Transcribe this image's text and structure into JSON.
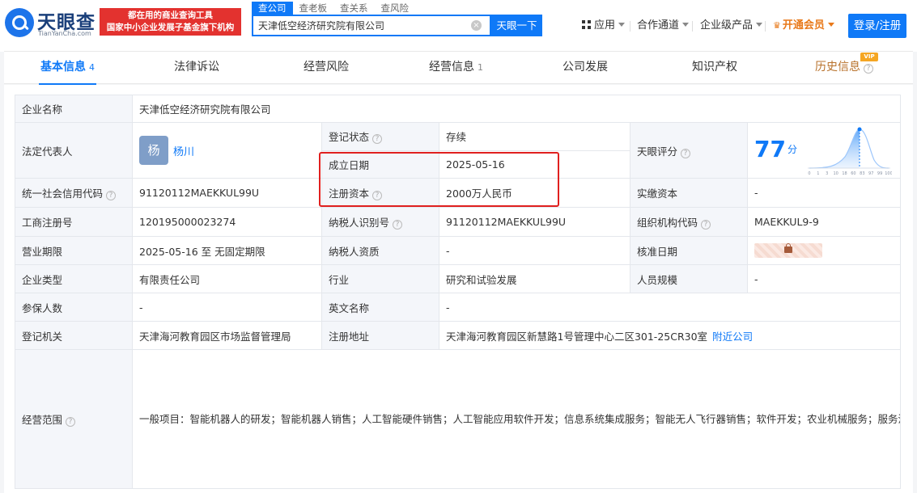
{
  "header": {
    "logo_name": "天眼查",
    "logo_domain": "TianYanCha.com",
    "slogan_line1": "都在用的商业查询工具",
    "slogan_line2": "国家中小企业发展子基金旗下机构",
    "search_tabs": [
      "查公司",
      "查老板",
      "查关系",
      "查风险"
    ],
    "search_value": "天津低空经济研究院有限公司",
    "search_button": "天眼一下",
    "nav_apps": "应用",
    "nav_channel": "合作通道",
    "nav_enterprise": "企业级产品",
    "nav_vip": "开通会员",
    "login": "登录/注册"
  },
  "tabs": [
    {
      "label": "基本信息",
      "count": "4"
    },
    {
      "label": "法律诉讼",
      "count": ""
    },
    {
      "label": "经营风险",
      "count": ""
    },
    {
      "label": "经营信息",
      "count": "1"
    },
    {
      "label": "公司发展",
      "count": ""
    },
    {
      "label": "知识产权",
      "count": ""
    },
    {
      "label": "历史信息",
      "count": ""
    }
  ],
  "vip_badge": "VIP",
  "info": {
    "company_name_label": "企业名称",
    "company_name": "天津低空经济研究院有限公司",
    "legal_rep_label": "法定代表人",
    "legal_rep_avatar": "杨",
    "legal_rep": "杨川",
    "reg_status_label": "登记状态",
    "reg_status": "存续",
    "score_label": "天眼评分",
    "score": "77",
    "score_unit": "分",
    "score_axis": [
      "0",
      "1",
      "3",
      "10",
      "18",
      "60",
      "83",
      "97",
      "99",
      "100"
    ],
    "founded_label": "成立日期",
    "founded": "2025-05-16",
    "uscc_label": "统一社会信用代码",
    "uscc": "91120112MAEKKUL99U",
    "reg_capital_label": "注册资本",
    "reg_capital": "2000万人民币",
    "paid_capital_label": "实缴资本",
    "paid_capital": "-",
    "biz_reg_no_label": "工商注册号",
    "biz_reg_no": "120195000023274",
    "taxpayer_id_label": "纳税人识别号",
    "taxpayer_id": "91120112MAEKKUL99U",
    "org_code_label": "组织机构代码",
    "org_code": "MAEKKUL9-9",
    "term_label": "营业期限",
    "term": "2025-05-16 至 无固定期限",
    "taxpayer_qual_label": "纳税人资质",
    "taxpayer_qual": "-",
    "approval_date_label": "核准日期",
    "type_label": "企业类型",
    "type": "有限责任公司",
    "industry_label": "行业",
    "industry": "研究和试验发展",
    "staff_size_label": "人员规模",
    "staff_size": "-",
    "insured_label": "参保人数",
    "insured": "-",
    "english_name_label": "英文名称",
    "english_name": "-",
    "authority_label": "登记机关",
    "authority": "天津海河教育园区市场监督管理局",
    "address_label": "注册地址",
    "address": "天津海河教育园区新慧路1号管理中心二区301-25CR30室",
    "nearby": "附近公司",
    "scope_label": "经营范围",
    "scope": "一般项目：智能机器人的研发；智能机器人销售；人工智能硬件销售；人工智能应用软件开发；信息系统集成服务；智能无人飞行器销售；软件开发；农业机械服务；服务消费机器人销售；地理遥感信息服务；导航、测绘、气象及海洋专用仪器销售；卫星通信服务；航空运输设备销售；卫星遥感应用系统集成；环境监测专用仪器仪表销售；海洋环境监测与探测装备销售；生态环境监测及检测仪器仪表销售；环境保护监测；海洋环境服务；大气环境污染防治服务；环境应急检测仪器仪表销售；生态资源监测；水环境污染防治服务；土壤环境污染防治服务；环保咨询服务；业务培训（不含教育培训、职业技能培训等需取得许可的培训）；农作物病虫害防治服务；摄像及视频制作服务；专用设备修理；通用设备修理；电气设备修理；人工智能行业应用系统集成服务；人工智能公共数据平台；人工智能基础软件开发；人工智能基础资源与技术平台；人工智能理论与算法软件开发；技术服务、技术开发、技术咨询、技术交流、技术转让、技术推广。（除依法须经批准的项目外，凭营业执照依法自主开展经营活动）许可项目：通用航空服务；民用航空器驾驶员培训；测绘服务。（依法须经批准的项目，经相关部门批准后方可开展经营活动，具体经营项目以相关部门批准文件或许可证件为准）"
  },
  "colors": {
    "primary": "#0f79f7",
    "slogan_bg": "#e3322f",
    "status_green": "#15a34a",
    "highlight_red": "#e0201f",
    "history_tab": "#b8722c"
  }
}
